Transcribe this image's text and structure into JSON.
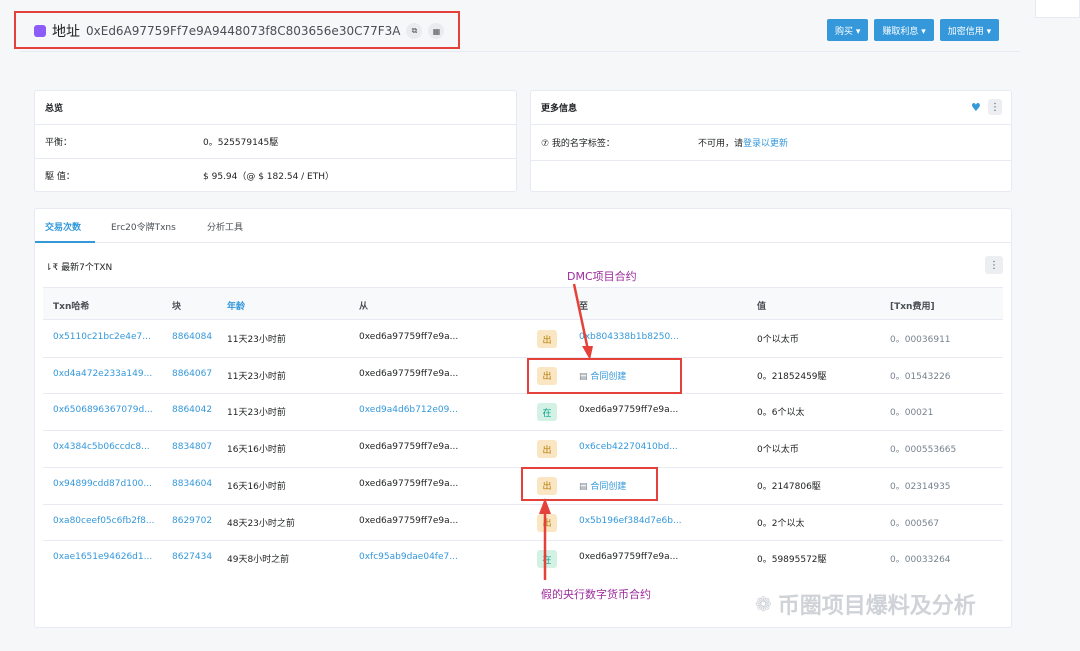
{
  "header": {
    "address_label": "地址",
    "address_hash": "0xEd6A97759Ff7e9A9448073f8C803656e30C77F3A",
    "copy_icon": "copy-icon",
    "qr_icon": "qr-icon",
    "buttons": [
      "购买 ▾",
      "赚取利息 ▾",
      "加密信用 ▾"
    ]
  },
  "overview": {
    "title": "总览",
    "balance_label": "平衡：",
    "balance_value": "0。525579145駆",
    "value_label": "駆 值：",
    "value_value": "$ 95.94（@ $ 182.54 / ETH）"
  },
  "more_info": {
    "title": "更多信息",
    "tag_label": "⑦ 我的名字标签：",
    "tag_prefix": "不可用，请",
    "tag_link": "登录以更新"
  },
  "tabs": [
    "交易次数",
    "Erc20令牌Txns",
    "分析工具"
  ],
  "txn_summary": "⇂₹ 最新7个TXN",
  "table": {
    "headers": [
      "Txn哈希",
      "块",
      "年龄",
      "从",
      "至",
      "值",
      "[Txn费用]"
    ],
    "rows": [
      {
        "hash": "0x5110c21bc2e4e7...",
        "block": "8864084",
        "age": "11天23小时前",
        "from": "0xed6a97759ff7e9a...",
        "dir": "出",
        "to": "0xb804338b1b8250...",
        "value": "0个以太币",
        "fee": "0。00036911"
      },
      {
        "hash": "0xd4a472e233a149...",
        "block": "8864067",
        "age": "11天23小时前",
        "from": "0xed6a97759ff7e9a...",
        "dir": "出",
        "to": "合同创建",
        "value": "0。21852459駆",
        "fee": "0。01543226"
      },
      {
        "hash": "0x6506896367079d...",
        "block": "8864042",
        "age": "11天23小时前",
        "from": "0xed9a4d6b712e09...",
        "dir": "在",
        "to": "0xed6a97759ff7e9a...",
        "value": "0。6个以太",
        "fee": "0。00021"
      },
      {
        "hash": "0x4384c5b06ccdc8...",
        "block": "8834807",
        "age": "16天16小时前",
        "from": "0xed6a97759ff7e9a...",
        "dir": "出",
        "to": "0x6ceb42270410bd...",
        "value": "0个以太币",
        "fee": "0。000553665"
      },
      {
        "hash": "0x94899cdd87d100...",
        "block": "8834604",
        "age": "16天16小时前",
        "from": "0xed6a97759ff7e9a...",
        "dir": "出",
        "to": "合同创建",
        "value": "0。2147806駆",
        "fee": "0。02314935"
      },
      {
        "hash": "0xa80ceef05c6fb2f8...",
        "block": "8629702",
        "age": "48天23小时之前",
        "from": "0xed6a97759ff7e9a...",
        "dir": "出",
        "to": "0x5b196ef384d7e6b...",
        "value": "0。2个以太",
        "fee": "0。000567"
      },
      {
        "hash": "0xae1651e94626d1...",
        "block": "8627434",
        "age": "49天8小时之前",
        "from": "0xfc95ab9dae04fe7...",
        "dir": "在",
        "to": "0xed6a97759ff7e9a...",
        "value": "0。59895572駆",
        "fee": "0。00033264"
      }
    ]
  },
  "annotations": {
    "dmc": "DMC项目合约",
    "fake": "假的央行数字货币合约"
  },
  "watermark": "币圈项目爆料及分析",
  "colors": {
    "accent": "#3498db",
    "annotation_box": "#e5413b",
    "annotation_text": "#9b2b9b"
  }
}
